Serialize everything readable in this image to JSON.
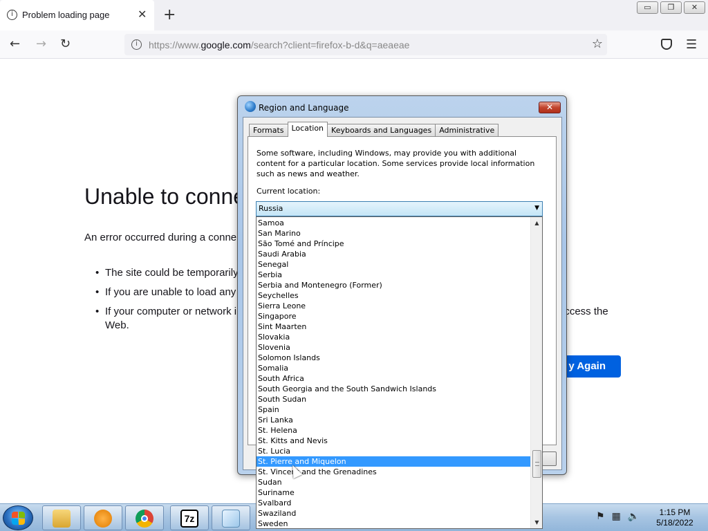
{
  "browser": {
    "tab_title": "Problem loading page",
    "tab_close": "✕",
    "new_tab": "+",
    "url_prefix": "https://www.",
    "url_domain": "google.com",
    "url_suffix": "/search?client=firefox-b-d&q=aeaeae",
    "window_controls": [
      "▭",
      "❐",
      "✕"
    ]
  },
  "error_page": {
    "title": "Unable to conne",
    "description": "An error occurred during a conne",
    "bullets": [
      "The site could be temporarily",
      "If you are unable to load any",
      "If your computer or network i"
    ],
    "bullet3_tail": "access the",
    "bullet3_tail2": "Web.",
    "try_again": "y Again"
  },
  "dialog": {
    "title": "Region and Language",
    "tabs": [
      "Formats",
      "Location",
      "Keyboards and Languages",
      "Administrative"
    ],
    "active_tab": "Location",
    "description": "Some software, including Windows, may provide you with additional content for a particular location. Some services provide local information such as news and weather.",
    "current_location_label": "Current location:",
    "current_location_value": "Russia",
    "close_glyph": "✕"
  },
  "dropdown": {
    "items": [
      "Samoa",
      "San Marino",
      "São Tomé and Príncipe",
      "Saudi Arabia",
      "Senegal",
      "Serbia",
      "Serbia and Montenegro (Former)",
      "Seychelles",
      "Sierra Leone",
      "Singapore",
      "Sint Maarten",
      "Slovakia",
      "Slovenia",
      "Solomon Islands",
      "Somalia",
      "South Africa",
      "South Georgia and the South Sandwich Islands",
      "South Sudan",
      "Spain",
      "Sri Lanka",
      "St. Helena",
      "St. Kitts and Nevis",
      "St. Lucia",
      "St. Pierre and Miquelon",
      "St. Vincent and the Grenadines",
      "Sudan",
      "Suriname",
      "Svalbard",
      "Swaziland",
      "Sweden"
    ],
    "highlighted": "St. Pierre and Miquelon"
  },
  "taskbar": {
    "apps": [
      "file-explorer-icon",
      "media-player-icon",
      "chrome-icon",
      "7zip-icon",
      "control-panel-icon"
    ],
    "sevenzip_label": "7z",
    "clock_time": "1:15 PM",
    "clock_date": "5/18/2022",
    "colors": {
      "accent": "#3399ff",
      "try_again": "#0061e0"
    }
  }
}
